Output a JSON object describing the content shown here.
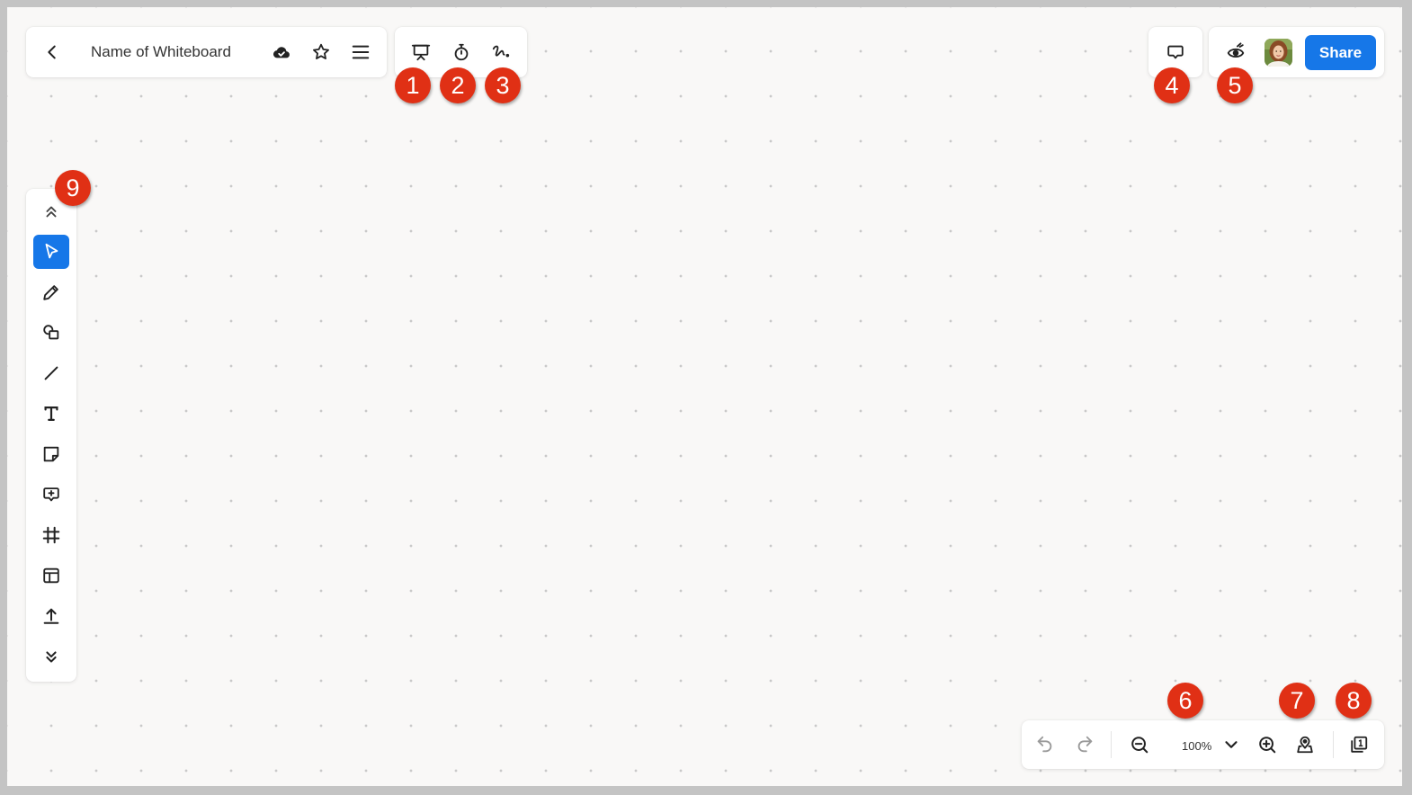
{
  "header": {
    "back_icon": "chevron-left-icon",
    "board_name": "Name of Whiteboard",
    "sync_icon": "cloud-check-icon",
    "favorite_icon": "star-icon",
    "menu_icon": "hamburger-menu-icon"
  },
  "session_tools": {
    "present_icon": "presentation-icon",
    "timer_icon": "stopwatch-icon",
    "pen_icon": "signature-icon"
  },
  "comments": {
    "icon": "comment-icon"
  },
  "collab": {
    "follow_icon": "eye-icon",
    "avatar_icon": "user-avatar",
    "share_label": "Share"
  },
  "toolbar": {
    "items": [
      {
        "name": "collapse-up",
        "icon": "chevrons-up-icon"
      },
      {
        "name": "select",
        "icon": "pointer-arrow-icon",
        "active": true
      },
      {
        "name": "pen",
        "icon": "pencil-icon"
      },
      {
        "name": "shapes",
        "icon": "shapes-icon"
      },
      {
        "name": "line",
        "icon": "line-icon"
      },
      {
        "name": "text",
        "icon": "text-icon"
      },
      {
        "name": "sticky-note",
        "icon": "sticky-note-icon"
      },
      {
        "name": "comment",
        "icon": "add-comment-icon"
      },
      {
        "name": "frame",
        "icon": "frame-icon"
      },
      {
        "name": "templates",
        "icon": "template-icon"
      },
      {
        "name": "upload",
        "icon": "upload-icon"
      },
      {
        "name": "expand-down",
        "icon": "chevrons-down-icon"
      }
    ]
  },
  "bottom_bar": {
    "undo_icon": "undo-icon",
    "redo_icon": "redo-icon",
    "zoom_out_icon": "zoom-out-icon",
    "zoom_level": "100%",
    "zoom_dropdown_icon": "chevron-down-icon",
    "zoom_in_icon": "zoom-in-icon",
    "locate_icon": "map-pin-icon",
    "pages_icon": "pages-icon"
  },
  "annotations": [
    "1",
    "2",
    "3",
    "4",
    "5",
    "6",
    "7",
    "8",
    "9"
  ],
  "colors": {
    "accent": "#1677e8",
    "badge": "#e03015",
    "canvas": "#f9f8f7",
    "dots": "#c9c9c9"
  }
}
